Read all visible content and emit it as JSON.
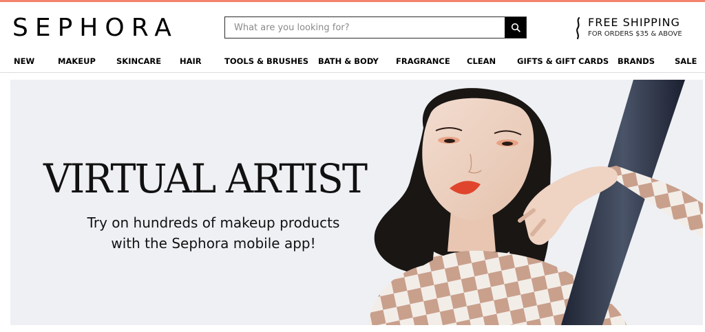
{
  "brand": {
    "logo_text": "SEPHORA",
    "accent_color": "#f2836d"
  },
  "search": {
    "placeholder": "What are you looking for?",
    "value": ""
  },
  "shipping": {
    "title": "FREE SHIPPING",
    "subtitle": "FOR ORDERS $35 & ABOVE"
  },
  "nav": {
    "items": [
      {
        "label": "NEW"
      },
      {
        "label": "MAKEUP"
      },
      {
        "label": "SKINCARE"
      },
      {
        "label": "HAIR"
      },
      {
        "label": "TOOLS & BRUSHES"
      },
      {
        "label": "BATH & BODY"
      },
      {
        "label": "FRAGRANCE"
      },
      {
        "label": "CLEAN"
      },
      {
        "label": "GIFTS & GIFT CARDS"
      },
      {
        "label": "BRANDS"
      },
      {
        "label": "SALE"
      }
    ]
  },
  "hero": {
    "title": "VIRTUAL ARTIST",
    "subtitle_line1": "Try on hundreds of makeup products",
    "subtitle_line2": "with the Sephora mobile app!",
    "background_color": "#eef0f4"
  }
}
